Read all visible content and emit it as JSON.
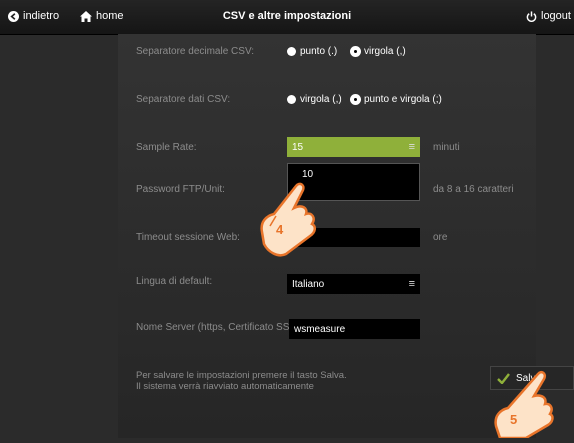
{
  "header": {
    "back_label": "indietro",
    "home_label": "home",
    "title": "CSV e altre impostazioni",
    "logout_label": "logout"
  },
  "settings": {
    "decimal_separator": {
      "label": "Separatore decimale CSV:",
      "options": [
        {
          "label": "punto (.)",
          "selected": false
        },
        {
          "label": "virgola (,)",
          "selected": true
        }
      ]
    },
    "data_separator": {
      "label": "Separatore dati CSV:",
      "options": [
        {
          "label": "virgola (,)",
          "selected": false
        },
        {
          "label": "punto e virgola (;)",
          "selected": true
        }
      ]
    },
    "sample_rate": {
      "label": "Sample Rate:",
      "value": "15",
      "unit": "minuti",
      "dropdown_options": [
        "10"
      ],
      "checked_mark": "✔"
    },
    "ftp_password": {
      "label": "Password FTP/Unit:",
      "hint": "da 8 a 16 caratteri"
    },
    "web_timeout": {
      "label": "Timeout sessione Web:",
      "unit": "ore"
    },
    "default_language": {
      "label": "Lingua di default:",
      "value": "Italiano"
    },
    "server_name": {
      "label": "Nome Server (https, Certificato SSL):",
      "value": "wsmeasure"
    }
  },
  "footer": {
    "note_line1": "Per salvare le impostazioni premere il tasto Salva.",
    "note_line2": "Il sistema verrà riavviato automaticamente",
    "save_label": "Salva"
  },
  "callouts": {
    "step4": "4",
    "step5": "5"
  },
  "colors": {
    "accent_green": "#8fb03a",
    "callout_orange": "#e8742a",
    "callout_fill": "#fde3c8"
  }
}
